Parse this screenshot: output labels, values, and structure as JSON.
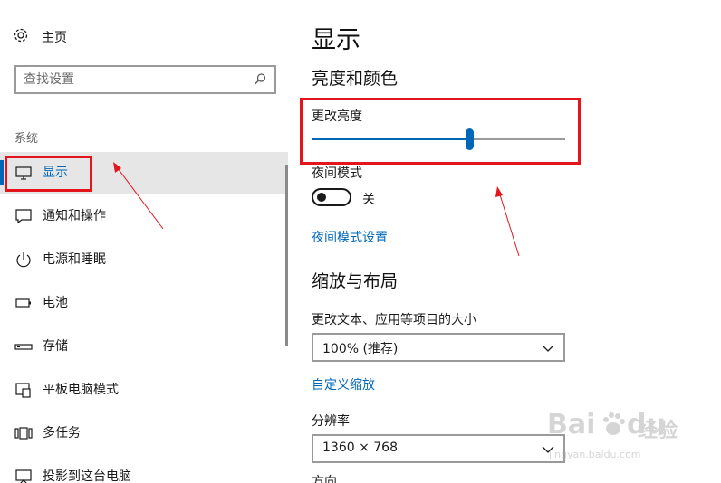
{
  "sidebar": {
    "home_label": "主页",
    "search_placeholder": "查找设置",
    "section_label": "系统",
    "items": [
      {
        "label": "显示",
        "icon": "monitor-icon",
        "active": true
      },
      {
        "label": "通知和操作",
        "icon": "notification-icon"
      },
      {
        "label": "电源和睡眠",
        "icon": "power-icon"
      },
      {
        "label": "电池",
        "icon": "battery-icon"
      },
      {
        "label": "存储",
        "icon": "storage-icon"
      },
      {
        "label": "平板电脑模式",
        "icon": "tablet-mode-icon"
      },
      {
        "label": "多任务",
        "icon": "multitasking-icon"
      },
      {
        "label": "投影到这台电脑",
        "icon": "project-icon"
      }
    ]
  },
  "main": {
    "title": "显示",
    "brightness_color_heading": "亮度和颜色",
    "brightness_label": "更改亮度",
    "brightness_value_percent": 62,
    "night_mode_label": "夜间模式",
    "night_mode_state": "关",
    "night_mode_settings_link": "夜间模式设置",
    "scale_layout_heading": "缩放与布局",
    "scale_label": "更改文本、应用等项目的大小",
    "scale_value": "100% (推荐)",
    "custom_scale_link": "自定义缩放",
    "resolution_label": "分辨率",
    "resolution_value": "1360 × 768",
    "cut_off_label": "方向"
  },
  "watermark": {
    "brand": "Bai",
    "brand2": "du",
    "cn": "经验",
    "url": "jingyan.baidu.com"
  },
  "colors": {
    "accent": "#0067b8",
    "annotation_red": "#e3141b",
    "active_bg": "#e6e6e6"
  }
}
